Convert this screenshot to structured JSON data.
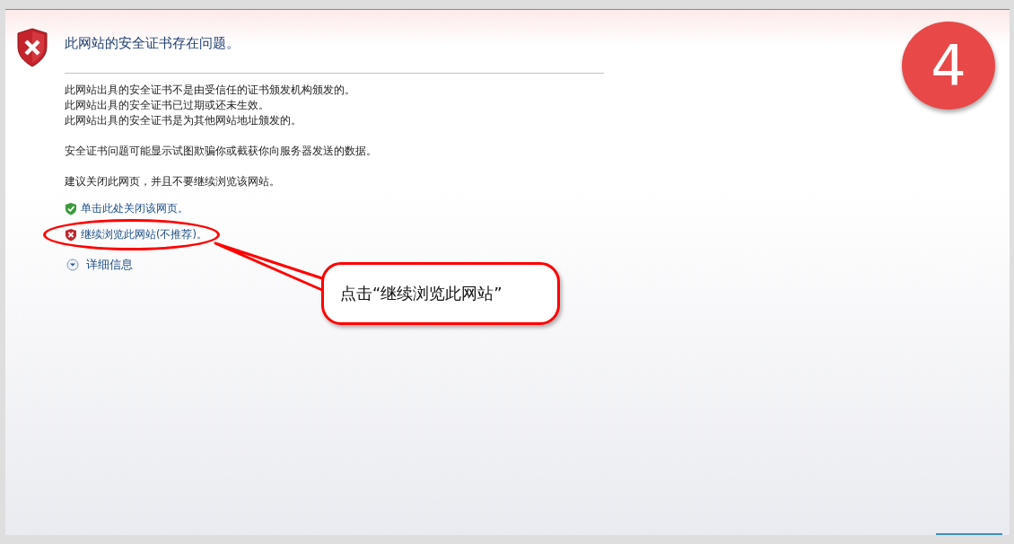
{
  "title": "此网站的安全证书存在问题。",
  "reasons": [
    "此网站出具的安全证书不是由受信任的证书颁发机构颁发的。",
    "此网站出具的安全证书已过期或还未生效。",
    "此网站出具的安全证书是为其他网站地址颁发的。"
  ],
  "warning": "安全证书问题可能显示试图欺骗你或截获你向服务器发送的数据。",
  "advice": "建议关闭此网页，并且不要继续浏览该网站。",
  "links": [
    {
      "kind": "safe",
      "label": "单击此处关闭该网页。",
      "circled": false
    },
    {
      "kind": "unsafe",
      "label": "继续浏览此网站(不推荐)。",
      "circled": true
    }
  ],
  "details": {
    "label": "详细信息",
    "expanded": false
  },
  "callout": "点击“继续浏览此网站”",
  "step_badge": "4"
}
